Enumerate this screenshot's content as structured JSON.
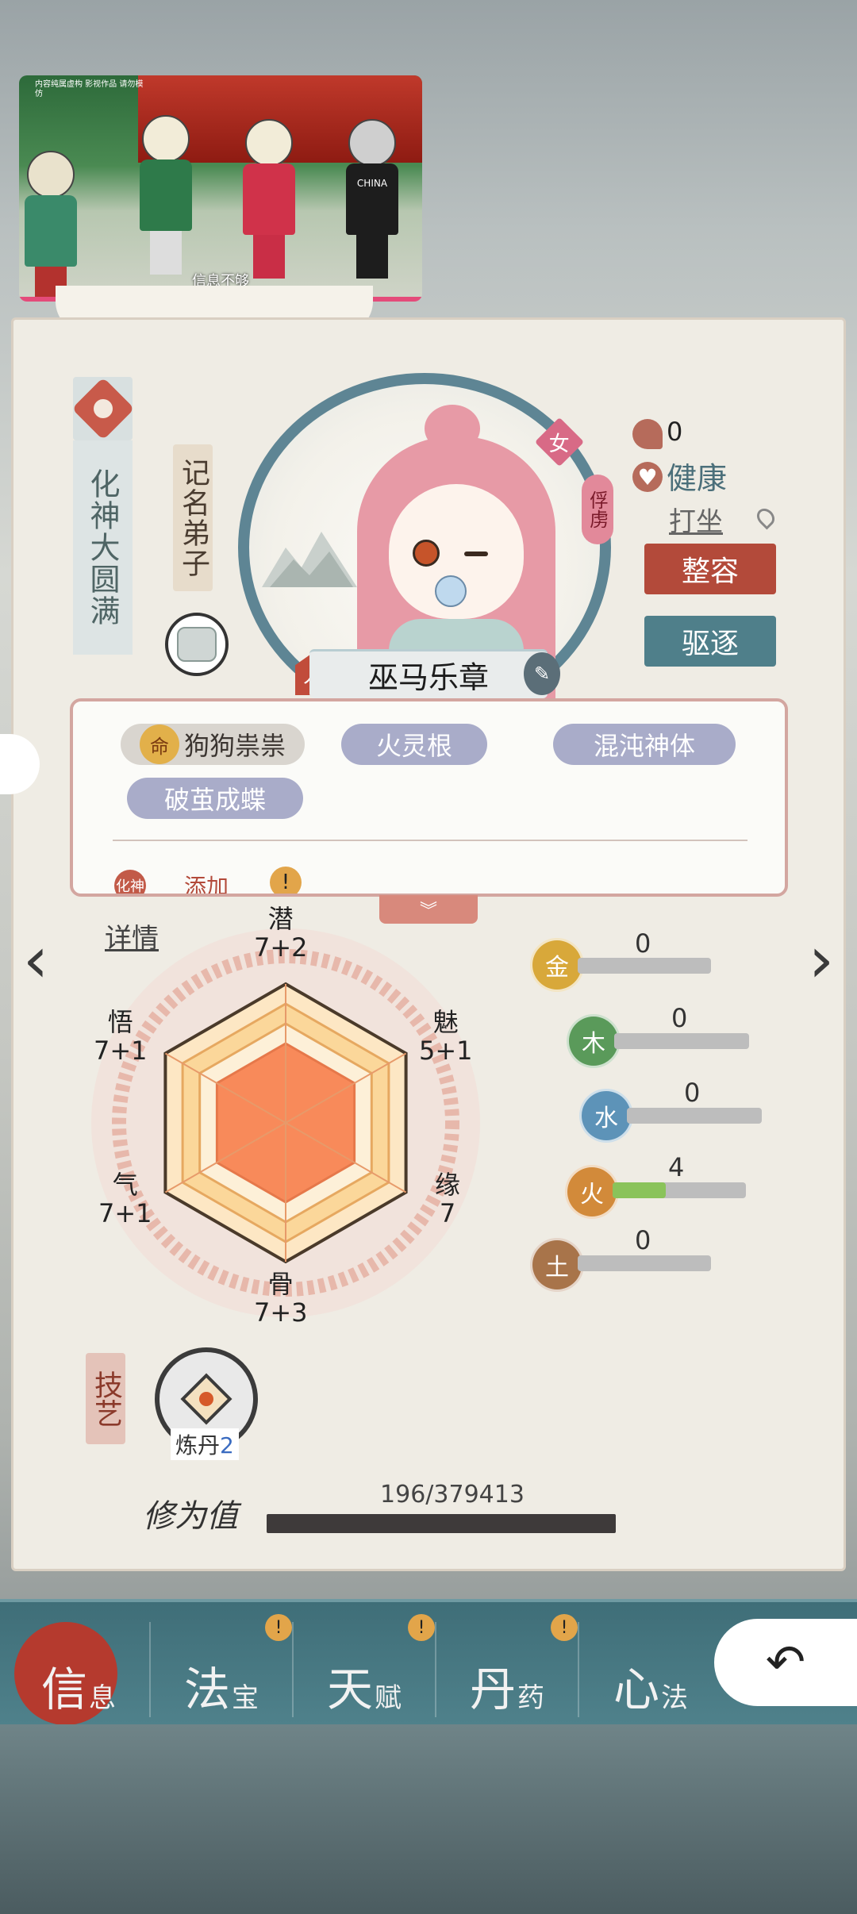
{
  "video": {
    "caption": "信息不够",
    "top_caption": "内容纯属虚构 影视作品 请勿模仿",
    "jersey_text": "CHINA"
  },
  "profile": {
    "realm": "化神大圆满",
    "rank": "记名弟子",
    "gender": "女",
    "status_tag": "俘虏",
    "name": "巫马乐章",
    "name_badge": "人",
    "luck_value": "0",
    "health": "健康",
    "action": "打坐",
    "buttons": {
      "makeover": "整容",
      "expel": "驱逐"
    }
  },
  "traits": {
    "fate_icon": "命",
    "tags": [
      "狗狗祟祟",
      "火灵根",
      "混沌神体",
      "破茧成蝶"
    ],
    "add_icon": "化神",
    "add_label": "添加",
    "alert": "!"
  },
  "detail_link": "详情",
  "attributes": [
    {
      "name": "潜",
      "value": "7+2"
    },
    {
      "name": "魅",
      "value": "5+1"
    },
    {
      "name": "缘",
      "value": "7"
    },
    {
      "name": "骨",
      "value": "7+3"
    },
    {
      "name": "气",
      "value": "7+1"
    },
    {
      "name": "悟",
      "value": "7+1"
    }
  ],
  "elements": [
    {
      "icon": "金",
      "value": 0,
      "color": "#d8a83a"
    },
    {
      "icon": "木",
      "value": 0,
      "color": "#5a9a5a"
    },
    {
      "icon": "水",
      "value": 0,
      "color": "#5d93b8"
    },
    {
      "icon": "火",
      "value": 4,
      "color": "#d28a3a"
    },
    {
      "icon": "土",
      "value": 0,
      "color": "#a8744a"
    }
  ],
  "skills": {
    "title": "技艺",
    "items": [
      {
        "name": "炼丹",
        "level": "2"
      }
    ]
  },
  "cultivation": {
    "label": "修为值",
    "value": "196/379413"
  },
  "tabs": [
    {
      "big": "信",
      "small": "息",
      "alert": false
    },
    {
      "big": "法",
      "small": "宝",
      "alert": true
    },
    {
      "big": "天",
      "small": "赋",
      "alert": true
    },
    {
      "big": "丹",
      "small": "药",
      "alert": true
    },
    {
      "big": "心",
      "small": "法",
      "alert": false
    }
  ],
  "tab_alert_symbol": "!",
  "nav": {
    "prev": "‹",
    "next": "›",
    "back": "↶",
    "expand": "︾"
  }
}
